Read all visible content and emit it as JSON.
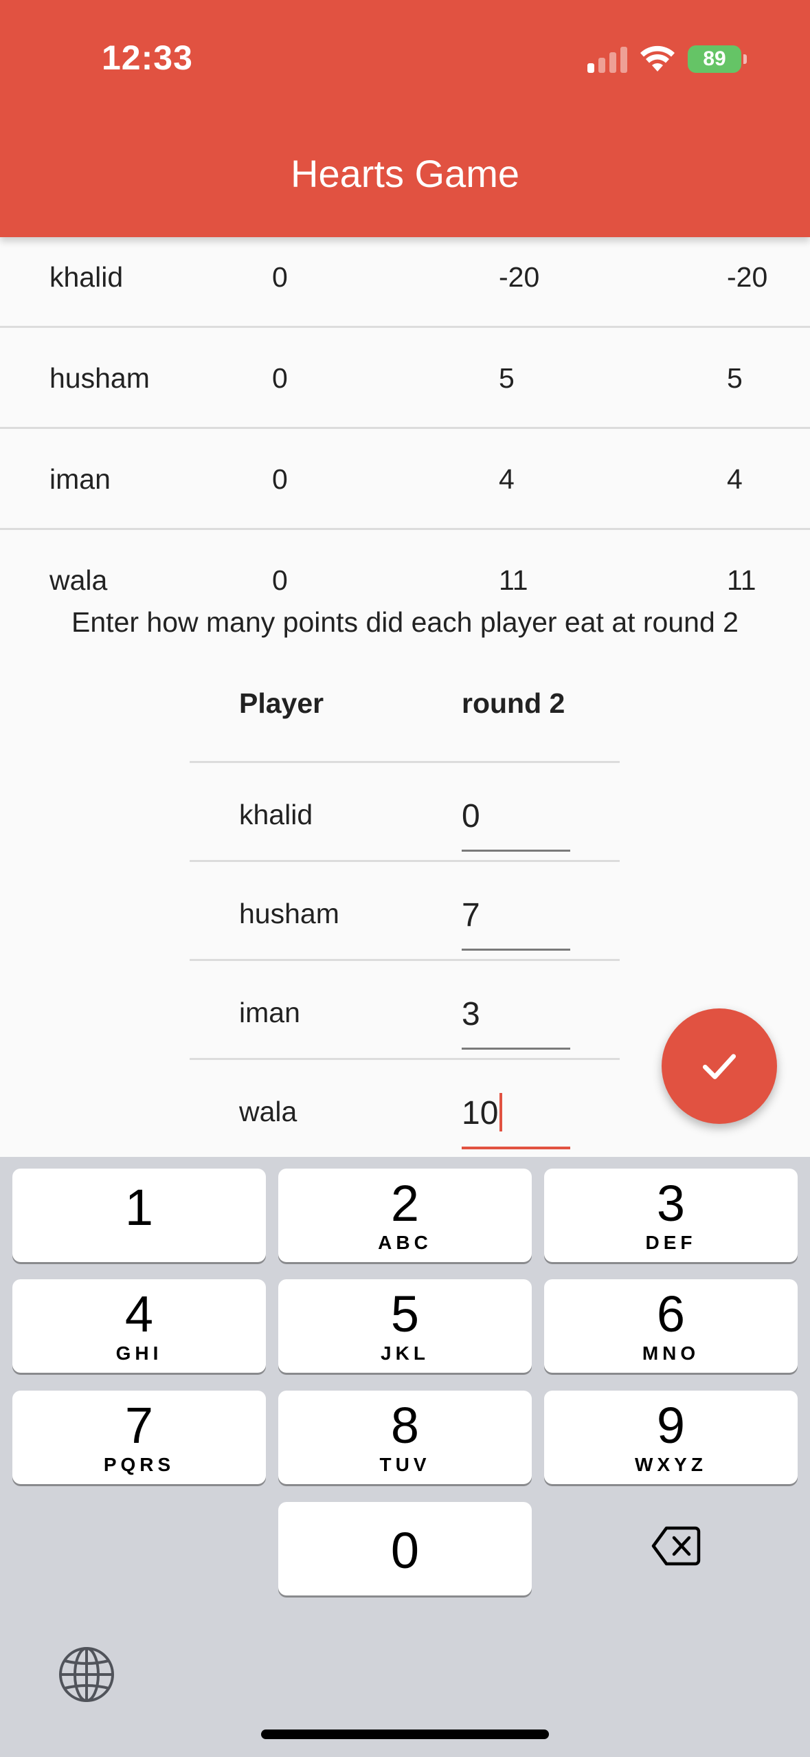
{
  "status_bar": {
    "time": "12:33",
    "battery": "89"
  },
  "app_bar": {
    "title": "Hearts Game"
  },
  "scores": [
    {
      "name": "khalid",
      "round1": "0",
      "round2": "-20",
      "total": "-20"
    },
    {
      "name": "husham",
      "round1": "0",
      "round2": "5",
      "total": "5"
    },
    {
      "name": "iman",
      "round1": "0",
      "round2": "4",
      "total": "4"
    },
    {
      "name": "wala",
      "round1": "0",
      "round2": "11",
      "total": "11"
    }
  ],
  "instruction": "Enter how many points did each player eat at round 2",
  "entry": {
    "header_player": "Player",
    "header_round": "round 2",
    "rows": [
      {
        "name": "khalid",
        "value": "0"
      },
      {
        "name": "husham",
        "value": "7"
      },
      {
        "name": "iman",
        "value": "3"
      },
      {
        "name": "wala",
        "value": "10"
      }
    ]
  },
  "fab": {
    "icon": "check-icon"
  },
  "keyboard": {
    "keys": [
      {
        "num": "1",
        "letters": ""
      },
      {
        "num": "2",
        "letters": "ABC"
      },
      {
        "num": "3",
        "letters": "DEF"
      },
      {
        "num": "4",
        "letters": "GHI"
      },
      {
        "num": "5",
        "letters": "JKL"
      },
      {
        "num": "6",
        "letters": "MNO"
      },
      {
        "num": "7",
        "letters": "PQRS"
      },
      {
        "num": "8",
        "letters": "TUV"
      },
      {
        "num": "9",
        "letters": "WXYZ"
      },
      {
        "num": "0",
        "letters": ""
      }
    ]
  },
  "colors": {
    "accent": "#e15241",
    "keyboard_bg": "#d1d3d9",
    "battery": "#65c466"
  }
}
